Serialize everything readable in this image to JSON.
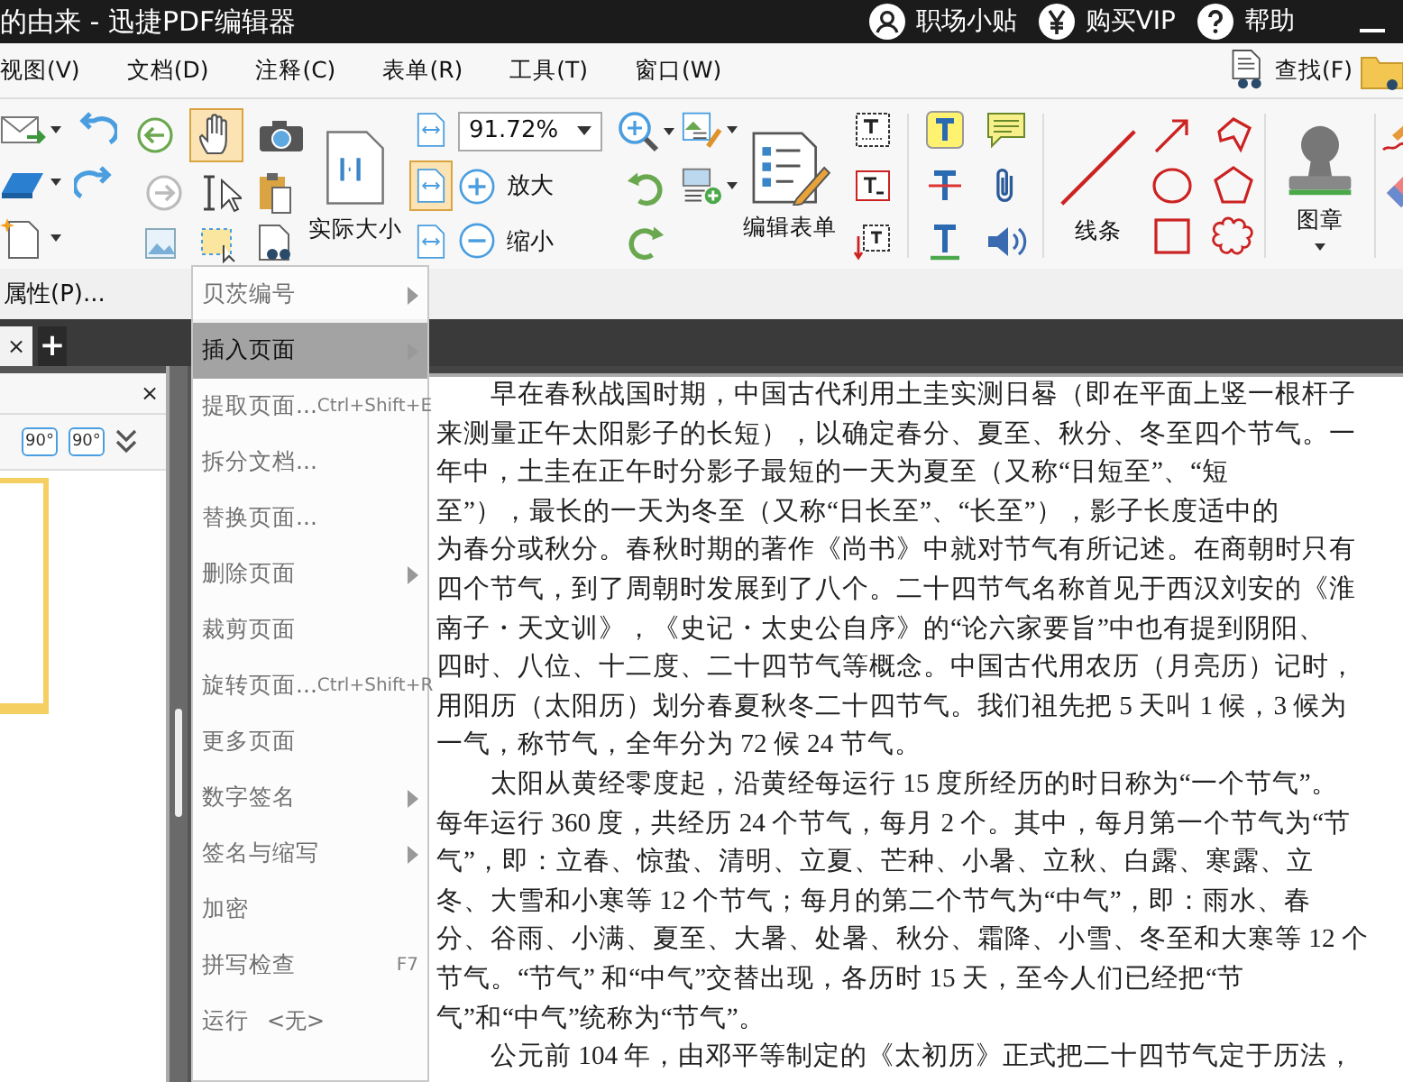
{
  "window": {
    "title": "的由来 - 迅捷PDF编辑器",
    "links": [
      {
        "kind": "user",
        "label": "职场小贴"
      },
      {
        "kind": "yen",
        "label": "购买VIP"
      },
      {
        "kind": "help",
        "label": "帮助"
      }
    ]
  },
  "menu": [
    "视图(V)",
    "文档(D)",
    "注释(C)",
    "表单(R)",
    "工具(T)",
    "窗口(W)"
  ],
  "find": "查找(F)",
  "toolbar": {
    "hand_selected": true,
    "actual_size": "实际大小",
    "fit_modes": [
      {
        "selected": false
      },
      {
        "selected": true
      },
      {
        "selected": false
      }
    ],
    "zoom": {
      "value": "91.72%"
    },
    "zoom_in": "放大",
    "zoom_out": "缩小",
    "edit_form": "编辑表单",
    "lines": "线条",
    "stamp": "图章"
  },
  "properties": "属性(P)...",
  "tabs": [
    {
      "selected": true,
      "close": "×"
    }
  ],
  "new_tab": "+",
  "side_panel": {
    "close": "×",
    "rotate": [
      "90°",
      "90°"
    ]
  },
  "document": {
    "paragraphs": [
      {
        "lines": [
          "早在春秋战国时期，中国古代利用土圭实测日晷（即在平面上竖一根杆子",
          "来测量正午太阳影子的长短），以确定春分、夏至、秋分、冬至四个节气。一",
          "年中，土圭在正午时分影子最短的一天为夏至（又称“日短至”、“短",
          "至”），最长的一天为冬至（又称“日长至”、“长至”），影子长度适中的",
          "为春分或秋分。春秋时期的著作《尚书》中就对节气有所记述。在商朝时只有",
          "四个节气，到了周朝时发展到了八个。二十四节气名称首见于西汉刘安的《淮",
          "南子・天文训》，《史记・太史公自序》的“论六家要旨”中也有提到阴阳、",
          "四时、八位、十二度、二十四节气等概念。中国古代用农历（月亮历）记时，",
          "用阳历（太阳历）划分春夏秋冬二十四节气。我们祖先把 5 天叫 1 候，3 候为",
          "一气，称节气，全年分为 72 候 24 节气。"
        ]
      },
      {
        "lines": [
          "太阳从黄经零度起，沿黄经每运行 15 度所经历的时日称为“一个节气”。",
          "每年运行 360 度，共经历 24 个节气，每月 2 个。其中，每月第一个节气为“节",
          "气”，即：立春、惊蛰、清明、立夏、芒种、小暑、立秋、白露、寒露、立",
          "冬、大雪和小寒等 12 个节气；每月的第二个节气为“中气”，即：雨水、春",
          "分、谷雨、小满、夏至、大暑、处暑、秋分、霜降、小雪、冬至和大寒等 12 个",
          "节气。“节气” 和“中气”交替出现，各历时 15 天，至今人们已经把“节",
          "气”和“中气”统称为“节气”。"
        ]
      },
      {
        "lines": [
          "公元前 104 年，由邓平等制定的《太初历》正式把二十四节气定于历法，"
        ]
      }
    ]
  },
  "context_menu": {
    "items": [
      {
        "label": "贝茨编号",
        "selected": false,
        "submenu": true
      },
      {
        "label": "插入页面",
        "selected": true,
        "submenu": true
      },
      {
        "label": "提取页面...",
        "shortcut": "Ctrl+Shift+E",
        "selected": false,
        "submenu": false
      },
      {
        "label": "拆分文档...",
        "selected": false,
        "submenu": false
      },
      {
        "label": "替换页面...",
        "selected": false,
        "submenu": false
      },
      {
        "label": "删除页面",
        "selected": false,
        "submenu": true
      },
      {
        "label": "裁剪页面",
        "selected": false,
        "submenu": false
      },
      {
        "label": "旋转页面...",
        "shortcut": "Ctrl+Shift+R",
        "selected": false,
        "submenu": false
      },
      {
        "label": "更多页面",
        "selected": false,
        "submenu": false
      },
      {
        "label": "数字签名",
        "selected": false,
        "submenu": true
      },
      {
        "label": "签名与缩写",
        "selected": false,
        "submenu": true
      },
      {
        "label": "加密",
        "selected": false,
        "submenu": false
      },
      {
        "label": "拼写检查",
        "shortcut": "F7",
        "selected": false,
        "submenu": false
      },
      {
        "label": "运行",
        "value": "<无>",
        "selected": false,
        "submenu": false
      }
    ]
  }
}
